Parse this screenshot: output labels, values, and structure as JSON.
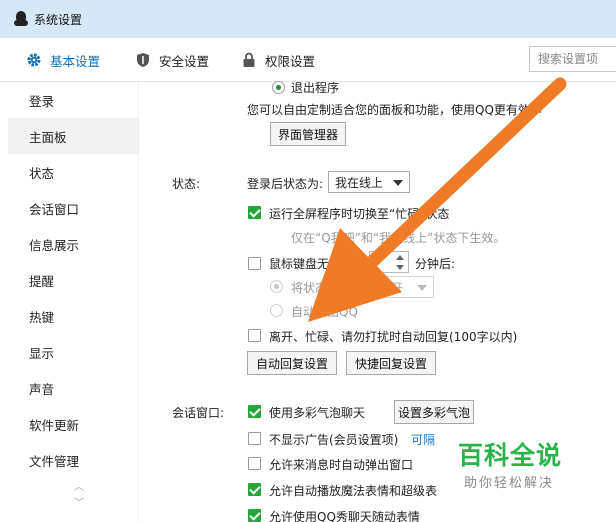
{
  "window": {
    "title": "系统设置"
  },
  "tabs": [
    {
      "label": "基本设置",
      "icon": "gear-icon",
      "active": true
    },
    {
      "label": "安全设置",
      "icon": "shield-icon",
      "active": false
    },
    {
      "label": "权限设置",
      "icon": "lock-icon",
      "active": false
    }
  ],
  "search": {
    "placeholder": "搜索设置项"
  },
  "sidebar": {
    "items": [
      {
        "label": "登录"
      },
      {
        "label": "主面板"
      },
      {
        "label": "状态"
      },
      {
        "label": "会话窗口"
      },
      {
        "label": "信息展示"
      },
      {
        "label": "提醒"
      },
      {
        "label": "热键"
      },
      {
        "label": "显示"
      },
      {
        "label": "声音"
      },
      {
        "label": "软件更新"
      },
      {
        "label": "文件管理"
      }
    ],
    "active": "主面板"
  },
  "panel": {
    "exit_option": "退出程序",
    "description": "您可以自由定制适合您的面板和功能，使用QQ更有效率",
    "interface_manager_button": "界面管理器"
  },
  "status_section": {
    "label": "状态:",
    "login_status_label": "登录后状态为:",
    "login_status_value": "我在线上",
    "fullscreen_option": "运行全屏程序时切换至“忙碌”状态",
    "fullscreen_note": "仅在“Q我吧”和“我在线上”状态下生效。",
    "idle_option": "鼠标键盘无动作",
    "idle_unit": "分钟后:",
    "switch_status_label": "将状态切换为",
    "switch_status_value": "离开",
    "auto_logout_option": "自动退出QQ",
    "auto_reply_option": "离开、忙碌、请勿打扰时自动回复(100字以内)",
    "auto_reply_button": "自动回复设置",
    "quick_reply_button": "快捷回复设置"
  },
  "chat_section": {
    "label": "会话窗口:",
    "colorful_bubble_option": "使用多彩气泡聊天",
    "colorful_bubble_button": "设置多彩气泡",
    "hide_ads_option": "不显示广告(会员设置项)",
    "hide_ads_link": "可隔",
    "auto_popup_option": "允许来消息时自动弹出窗口",
    "magic_emoji_option": "允许自动播放魔法表情和超级表",
    "last_option": "允许使用QQ秀聊天随动表情"
  },
  "watermark": {
    "main": "百科全说",
    "sub": "助你轻松解决"
  },
  "colors": {
    "accent": "#0d6fb8",
    "check_green": "#25a53a",
    "arrow_orange": "#f07b26",
    "titlebar": "#d6e8f7"
  }
}
